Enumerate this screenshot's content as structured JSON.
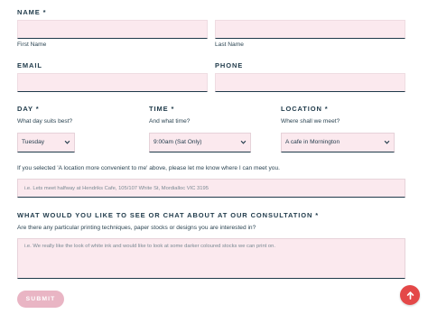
{
  "name": {
    "label": "NAME *",
    "first_sublabel": "First Name",
    "last_sublabel": "Last Name",
    "first_value": "",
    "last_value": ""
  },
  "email": {
    "label": "EMAIL",
    "value": ""
  },
  "phone": {
    "label": "PHONE",
    "value": ""
  },
  "day": {
    "label": "DAY *",
    "question": "What day suits best?",
    "selected": "Tuesday"
  },
  "time": {
    "label": "TIME *",
    "question": "And what time?",
    "selected": "9:00am (Sat Only)"
  },
  "location": {
    "label": "LOCATION *",
    "question": "Where shall we meet?",
    "selected": "A cafe in Mornington"
  },
  "alt_location": {
    "help": "If you selected 'A location more convenient to me' above, please let me know where I can meet you.",
    "placeholder": "i.e. Lets meet halfway at Hendriks Cafe, 105/107 White St, Mordialloc VIC 3195"
  },
  "consultation": {
    "label": "WHAT WOULD YOU LIKE TO SEE OR CHAT ABOUT AT OUR CONSULTATION *",
    "question": "Are there any particular printing techniques, paper stocks or designs you are interested in?",
    "placeholder": "i.e. We really like the look of white ink and would like to look at some darker coloured stocks we can print on."
  },
  "submit_label": "SUBMIT",
  "icons": {
    "select_caret": "chevron-down-icon",
    "scroll_top": "arrow-up-icon"
  },
  "colors": {
    "field_bg": "#fbe9ee",
    "text": "#1f3a4a",
    "submit_bg": "#e9b5c4",
    "fab_bg": "#e44848"
  }
}
